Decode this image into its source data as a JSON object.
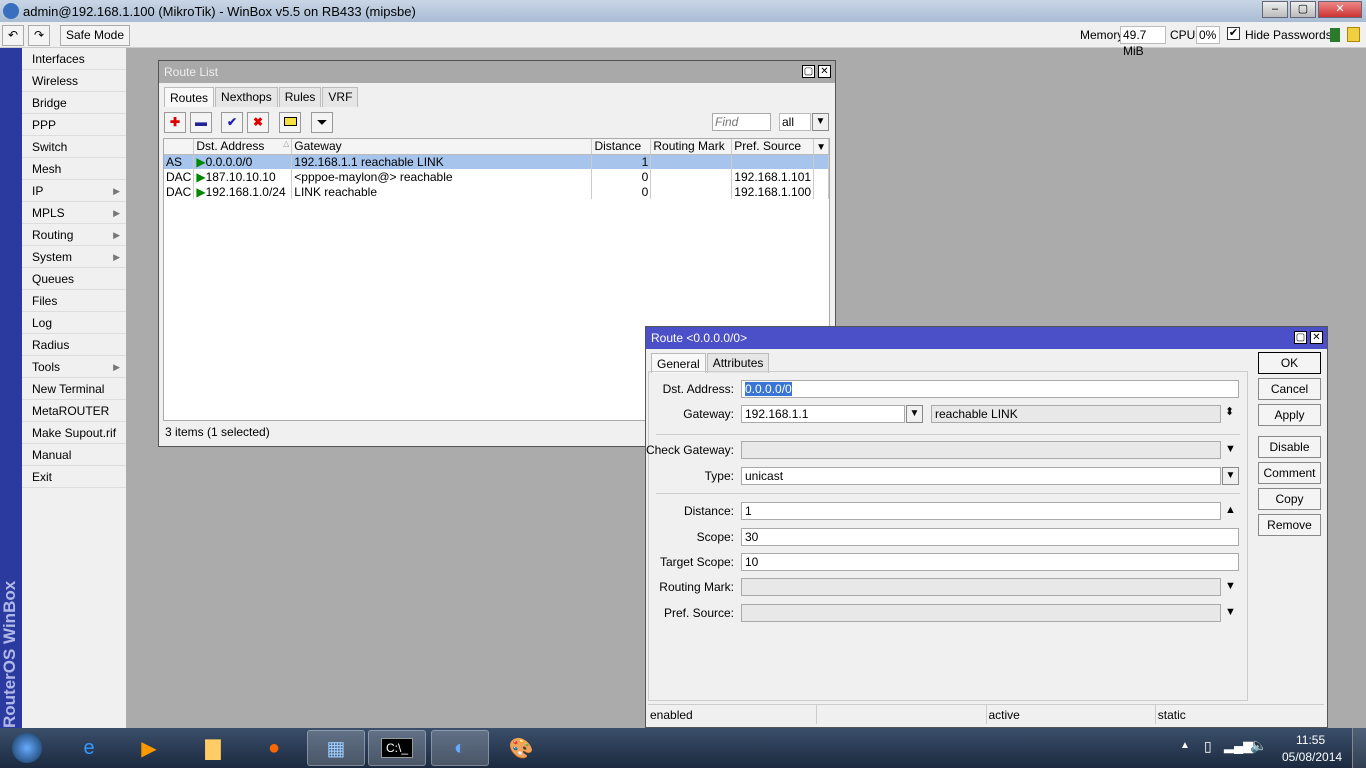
{
  "app": {
    "title": "admin@192.168.1.100 (MikroTik) - WinBox v5.5 on RB433 (mipsbe)"
  },
  "toolbar": {
    "safe_mode": "Safe Mode",
    "memory_label": "Memory:",
    "memory": "49.7 MiB",
    "cpu_label": "CPU:",
    "cpu": "0%",
    "hide_passwords": "Hide Passwords",
    "hide_passwords_checked": true
  },
  "sidebar": {
    "brand": "RouterOS WinBox",
    "items": [
      {
        "label": "Interfaces"
      },
      {
        "label": "Wireless"
      },
      {
        "label": "Bridge"
      },
      {
        "label": "PPP"
      },
      {
        "label": "Switch"
      },
      {
        "label": "Mesh"
      },
      {
        "label": "IP",
        "sub": true
      },
      {
        "label": "MPLS",
        "sub": true
      },
      {
        "label": "Routing",
        "sub": true
      },
      {
        "label": "System",
        "sub": true
      },
      {
        "label": "Queues"
      },
      {
        "label": "Files"
      },
      {
        "label": "Log"
      },
      {
        "label": "Radius"
      },
      {
        "label": "Tools",
        "sub": true
      },
      {
        "label": "New Terminal"
      },
      {
        "label": "MetaROUTER"
      },
      {
        "label": "Make Supout.rif"
      },
      {
        "label": "Manual"
      },
      {
        "label": "Exit"
      }
    ]
  },
  "route_list": {
    "title": "Route List",
    "tabs": [
      "Routes",
      "Nexthops",
      "Rules",
      "VRF"
    ],
    "find_placeholder": "Find",
    "filter": "all",
    "columns": [
      "",
      "Dst. Address",
      "Gateway",
      "Distance",
      "Routing Mark",
      "Pref. Source"
    ],
    "rows": [
      {
        "flags": "AS",
        "dst": "0.0.0.0/0",
        "gateway": "192.168.1.1 reachable LINK",
        "distance": "1",
        "mark": "",
        "pref": ""
      },
      {
        "flags": "DAC",
        "dst": "187.10.10.10",
        "gateway": "<pppoe-maylon@> reachable",
        "distance": "0",
        "mark": "",
        "pref": "192.168.1.101"
      },
      {
        "flags": "DAC",
        "dst": "192.168.1.0/24",
        "gateway": "LINK reachable",
        "distance": "0",
        "mark": "",
        "pref": "192.168.1.100"
      }
    ],
    "status": "3 items (1 selected)"
  },
  "route_dialog": {
    "title": "Route <0.0.0.0/0>",
    "tabs": [
      "General",
      "Attributes"
    ],
    "labels": {
      "dst": "Dst. Address:",
      "gateway": "Gateway:",
      "check_gateway": "Check Gateway:",
      "type": "Type:",
      "distance": "Distance:",
      "scope": "Scope:",
      "target_scope": "Target Scope:",
      "routing_mark": "Routing Mark:",
      "pref_source": "Pref. Source:"
    },
    "values": {
      "dst": "0.0.0.0/0",
      "gateway": "192.168.1.1",
      "gateway_state": "reachable LINK",
      "check_gateway": "",
      "type": "unicast",
      "distance": "1",
      "scope": "30",
      "target_scope": "10",
      "routing_mark": "",
      "pref_source": ""
    },
    "buttons": [
      "OK",
      "Cancel",
      "Apply",
      "Disable",
      "Comment",
      "Copy",
      "Remove"
    ],
    "status": [
      "enabled",
      "",
      "active",
      "static"
    ]
  },
  "taskbar": {
    "time": "11:55",
    "date": "05/08/2014"
  },
  "colors": {
    "dialog_title": "#4b4fc8",
    "selection": "#a6c4ec",
    "sidebar_strip": "#2b3a9e"
  }
}
